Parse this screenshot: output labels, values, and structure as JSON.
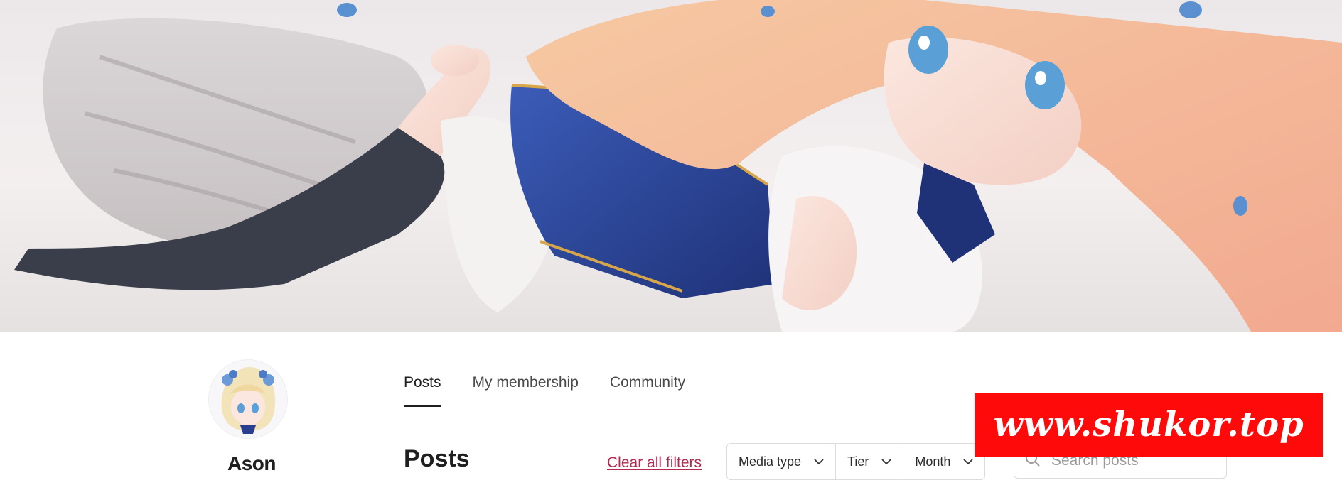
{
  "creator": {
    "name": "Ason"
  },
  "tabs": [
    {
      "label": "Posts",
      "active": true
    },
    {
      "label": "My membership",
      "active": false
    },
    {
      "label": "Community",
      "active": false
    }
  ],
  "posts_section": {
    "title": "Posts",
    "clear_filters_label": "Clear all filters",
    "filters": [
      {
        "label": "Media type",
        "icon": "chevron-down-icon"
      },
      {
        "label": "Tier",
        "icon": "chevron-down-icon"
      },
      {
        "label": "Month",
        "icon": "chevron-down-icon"
      }
    ],
    "search": {
      "placeholder": "Search posts",
      "value": "",
      "icon": "search-icon"
    }
  },
  "watermark": {
    "text": "www.shukor.top"
  },
  "colors": {
    "accent_link": "#b22a4f",
    "watermark_bg": "#ff0a0a"
  }
}
